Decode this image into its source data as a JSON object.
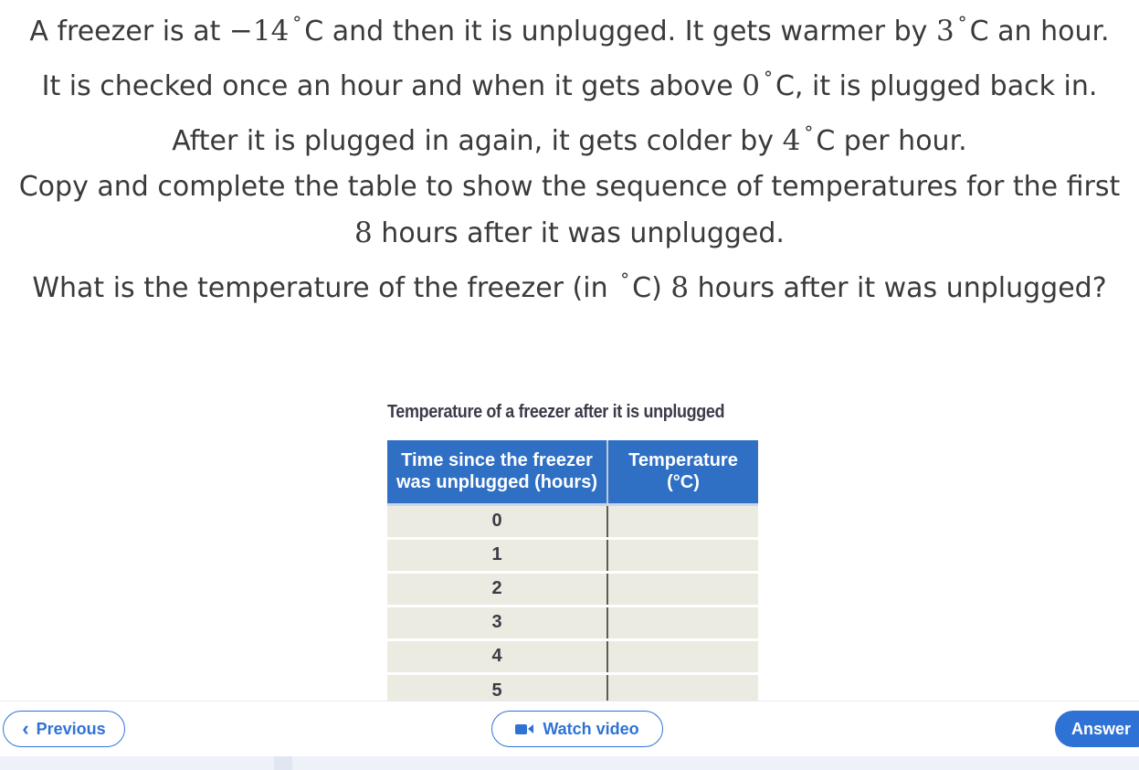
{
  "question": {
    "p1": {
      "t1": "A freezer is at ",
      "start_temp": "−14",
      "t2": "C and then it is unplugged. It gets warmer by ",
      "warm_rate": "3",
      "t3": "C an hour. It is checked once an hour and when it gets above ",
      "threshold": "0",
      "t4": "C, it is plugged back in. After it is plugged in again, it gets colder by ",
      "cool_rate": "4",
      "t5": "C per hour."
    },
    "p2": {
      "t1": "Copy and complete the table to show the sequence of temperatures for the first ",
      "hours": "8",
      "t2": " hours after it was unplugged."
    },
    "p3": {
      "t1": "What is the temperature of the freezer (in ",
      "t2": "C) ",
      "hours": "8",
      "t3": " hours after it was unplugged?"
    },
    "degree_symbol": "°"
  },
  "table": {
    "title": "Temperature of a freezer after it is unplugged",
    "headers": [
      "Time since the freezer was unplugged (hours)",
      "Temperature (°C)"
    ],
    "rows": [
      {
        "hours": "0",
        "temp": ""
      },
      {
        "hours": "1",
        "temp": ""
      },
      {
        "hours": "2",
        "temp": ""
      },
      {
        "hours": "3",
        "temp": ""
      },
      {
        "hours": "4",
        "temp": ""
      },
      {
        "hours": "5",
        "temp": ""
      }
    ]
  },
  "footer": {
    "previous_label": "Previous",
    "video_label": "Watch video",
    "answer_label": "Answer",
    "icons": {
      "previous": "chevron-left-icon",
      "video": "video-camera-icon"
    },
    "accent_color": "#2f72d6"
  }
}
